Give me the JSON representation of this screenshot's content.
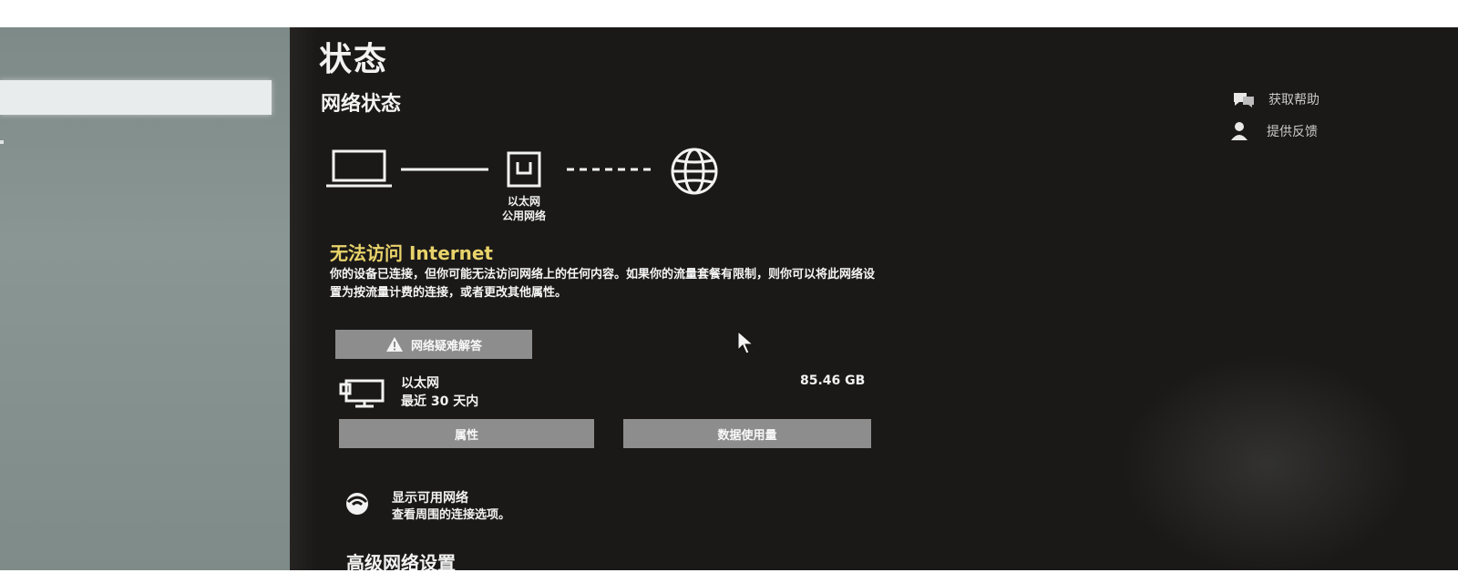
{
  "page": {
    "title": "状态",
    "section_title": "网络状态"
  },
  "diagram": {
    "adapter_name": "以太网",
    "network_type": "公用网络"
  },
  "warning": {
    "title": "无法访问 Internet",
    "body": "你的设备已连接，但你可能无法访问网络上的任何内容。如果你的流量套餐有限制，则你可以将此网络设置为按流量计费的连接，或者更改其他属性。",
    "color": "#e8d36a"
  },
  "troubleshoot_button": {
    "label": "网络疑难解答",
    "icon": "warning-icon"
  },
  "ethernet": {
    "name": "以太网",
    "period": "最近 30 天内",
    "usage": "85.46 GB",
    "properties_label": "属性",
    "data_usage_label": "数据使用量"
  },
  "show_networks": {
    "title": "显示可用网络",
    "subtitle": "查看周围的连接选项。"
  },
  "advanced": {
    "title": "高级网络设置"
  },
  "aside": {
    "help_label": "获取帮助",
    "feedback_label": "提供反馈"
  }
}
